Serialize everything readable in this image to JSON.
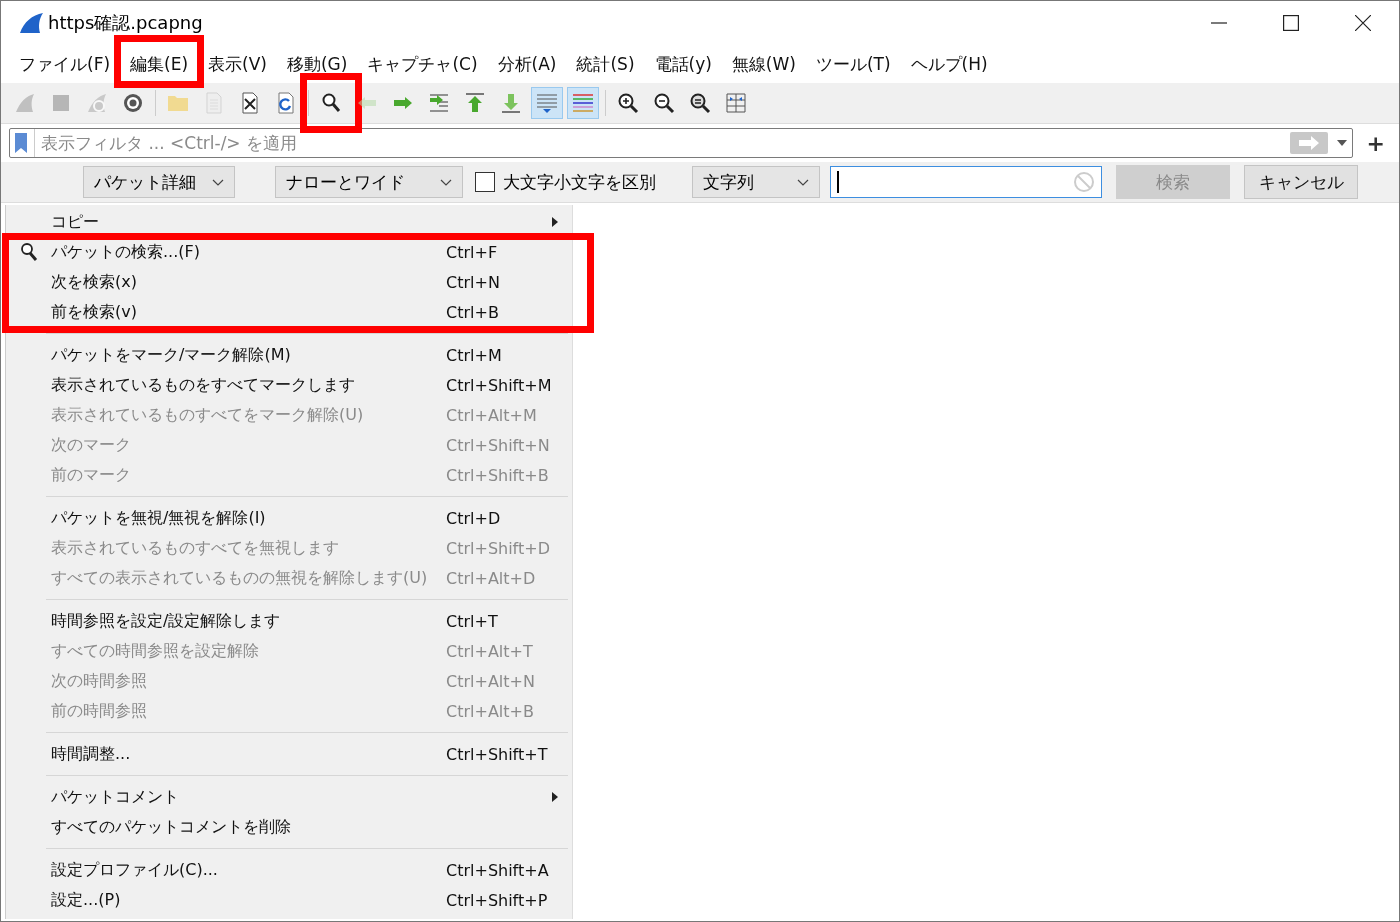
{
  "window": {
    "title": "https確認.pcapng"
  },
  "menubar": [
    {
      "label": "ファイル(F)",
      "highlighted": false
    },
    {
      "label": "編集(E)",
      "highlighted": true
    },
    {
      "label": "表示(V)",
      "highlighted": false
    },
    {
      "label": "移動(G)",
      "highlighted": false
    },
    {
      "label": "キャプチャ(C)",
      "highlighted": false
    },
    {
      "label": "分析(A)",
      "highlighted": false
    },
    {
      "label": "統計(S)",
      "highlighted": false
    },
    {
      "label": "電話(y)",
      "highlighted": false
    },
    {
      "label": "無線(W)",
      "highlighted": false
    },
    {
      "label": "ツール(T)",
      "highlighted": false
    },
    {
      "label": "ヘルプ(H)",
      "highlighted": false
    }
  ],
  "toolbar": [
    {
      "kind": "fin",
      "disabled": true,
      "pressed": false,
      "highlighted": false
    },
    {
      "kind": "stop",
      "disabled": true,
      "pressed": false,
      "highlighted": false
    },
    {
      "kind": "restart",
      "disabled": true,
      "pressed": false,
      "highlighted": false
    },
    {
      "kind": "gear",
      "disabled": false,
      "pressed": false,
      "highlighted": false
    },
    {
      "kind": "separator"
    },
    {
      "kind": "folder",
      "disabled": true,
      "pressed": false,
      "highlighted": false
    },
    {
      "kind": "file",
      "disabled": true,
      "pressed": false,
      "highlighted": false
    },
    {
      "kind": "close-file",
      "disabled": false,
      "pressed": false,
      "highlighted": false
    },
    {
      "kind": "reload",
      "disabled": false,
      "pressed": false,
      "highlighted": false
    },
    {
      "kind": "separator"
    },
    {
      "kind": "search",
      "disabled": false,
      "pressed": false,
      "highlighted": true
    },
    {
      "kind": "back",
      "disabled": true,
      "pressed": false,
      "highlighted": false
    },
    {
      "kind": "forward",
      "disabled": false,
      "pressed": false,
      "highlighted": false
    },
    {
      "kind": "goto",
      "disabled": false,
      "pressed": false,
      "highlighted": false
    },
    {
      "kind": "first",
      "disabled": false,
      "pressed": false,
      "highlighted": false
    },
    {
      "kind": "last",
      "disabled": false,
      "pressed": false,
      "highlighted": false
    },
    {
      "kind": "autoscroll",
      "disabled": false,
      "pressed": true,
      "highlighted": false
    },
    {
      "kind": "colorize",
      "disabled": false,
      "pressed": true,
      "highlighted": false
    },
    {
      "kind": "separator"
    },
    {
      "kind": "zoom-in",
      "disabled": false,
      "pressed": false,
      "highlighted": false
    },
    {
      "kind": "zoom-out",
      "disabled": false,
      "pressed": false,
      "highlighted": false
    },
    {
      "kind": "zoom-normal",
      "disabled": false,
      "pressed": false,
      "highlighted": false
    },
    {
      "kind": "resize-columns",
      "disabled": false,
      "pressed": false,
      "highlighted": false
    }
  ],
  "filter": {
    "placeholder": "表示フィルタ ... <Ctrl-/> を適用",
    "plus": "+"
  },
  "find_bar": {
    "search_in": "パケット詳細",
    "char_width": "ナローとワイド",
    "case_sensitive": {
      "label": "大文字小文字を区別",
      "checked": false
    },
    "search_type": "文字列",
    "find_button": {
      "label": "検索",
      "disabled": true
    },
    "cancel_button": {
      "label": "キャンセル",
      "disabled": false
    }
  },
  "edit_menu": [
    {
      "kind": "item",
      "label": "コピー",
      "disabled": false,
      "submenu": true,
      "icon": false,
      "highlighted": false
    },
    {
      "kind": "item",
      "label": "パケットの検索...(F)",
      "shortcut": "Ctrl+F",
      "disabled": false,
      "submenu": false,
      "icon": true,
      "highlighted": true
    },
    {
      "kind": "item",
      "label": "次を検索(x)",
      "shortcut": "Ctrl+N",
      "disabled": false,
      "submenu": false,
      "icon": false,
      "highlighted": true
    },
    {
      "kind": "item",
      "label": "前を検索(v)",
      "shortcut": "Ctrl+B",
      "disabled": false,
      "submenu": false,
      "icon": false,
      "highlighted": true
    },
    {
      "kind": "separator"
    },
    {
      "kind": "item",
      "label": "パケットをマーク/マーク解除(M)",
      "shortcut": "Ctrl+M",
      "disabled": false,
      "submenu": false,
      "icon": false,
      "highlighted": false
    },
    {
      "kind": "item",
      "label": "表示されているものをすべてマークします",
      "shortcut": "Ctrl+Shift+M",
      "disabled": false,
      "submenu": false,
      "icon": false,
      "highlighted": false
    },
    {
      "kind": "item",
      "label": "表示されているものすべてをマーク解除(U)",
      "shortcut": "Ctrl+Alt+M",
      "disabled": true,
      "submenu": false,
      "icon": false,
      "highlighted": false
    },
    {
      "kind": "item",
      "label": "次のマーク",
      "shortcut": "Ctrl+Shift+N",
      "disabled": true,
      "submenu": false,
      "icon": false,
      "highlighted": false
    },
    {
      "kind": "item",
      "label": "前のマーク",
      "shortcut": "Ctrl+Shift+B",
      "disabled": true,
      "submenu": false,
      "icon": false,
      "highlighted": false
    },
    {
      "kind": "separator"
    },
    {
      "kind": "item",
      "label": "パケットを無視/無視を解除(I)",
      "shortcut": "Ctrl+D",
      "disabled": false,
      "submenu": false,
      "icon": false,
      "highlighted": false
    },
    {
      "kind": "item",
      "label": "表示されているものすべてを無視します",
      "shortcut": "Ctrl+Shift+D",
      "disabled": true,
      "submenu": false,
      "icon": false,
      "highlighted": false
    },
    {
      "kind": "item",
      "label": "すべての表示されているものの無視を解除します(U)",
      "shortcut": "Ctrl+Alt+D",
      "disabled": true,
      "submenu": false,
      "icon": false,
      "highlighted": false
    },
    {
      "kind": "separator"
    },
    {
      "kind": "item",
      "label": "時間参照を設定/設定解除します",
      "shortcut": "Ctrl+T",
      "disabled": false,
      "submenu": false,
      "icon": false,
      "highlighted": false
    },
    {
      "kind": "item",
      "label": "すべての時間参照を設定解除",
      "shortcut": "Ctrl+Alt+T",
      "disabled": true,
      "submenu": false,
      "icon": false,
      "highlighted": false
    },
    {
      "kind": "item",
      "label": "次の時間参照",
      "shortcut": "Ctrl+Alt+N",
      "disabled": true,
      "submenu": false,
      "icon": false,
      "highlighted": false
    },
    {
      "kind": "item",
      "label": "前の時間参照",
      "shortcut": "Ctrl+Alt+B",
      "disabled": true,
      "submenu": false,
      "icon": false,
      "highlighted": false
    },
    {
      "kind": "separator"
    },
    {
      "kind": "item",
      "label": "時間調整...",
      "shortcut": "Ctrl+Shift+T",
      "disabled": false,
      "submenu": false,
      "icon": false,
      "highlighted": false
    },
    {
      "kind": "separator"
    },
    {
      "kind": "item",
      "label": "パケットコメント",
      "disabled": false,
      "submenu": true,
      "icon": false,
      "highlighted": false
    },
    {
      "kind": "item",
      "label": "すべてのパケットコメントを削除",
      "disabled": false,
      "submenu": false,
      "icon": false,
      "highlighted": false
    },
    {
      "kind": "separator"
    },
    {
      "kind": "item",
      "label": "設定プロファイル(C)...",
      "shortcut": "Ctrl+Shift+A",
      "disabled": false,
      "submenu": false,
      "icon": false,
      "highlighted": false
    },
    {
      "kind": "item",
      "label": "設定...(P)",
      "shortcut": "Ctrl+Shift+P",
      "disabled": false,
      "submenu": false,
      "icon": false,
      "highlighted": false
    }
  ]
}
